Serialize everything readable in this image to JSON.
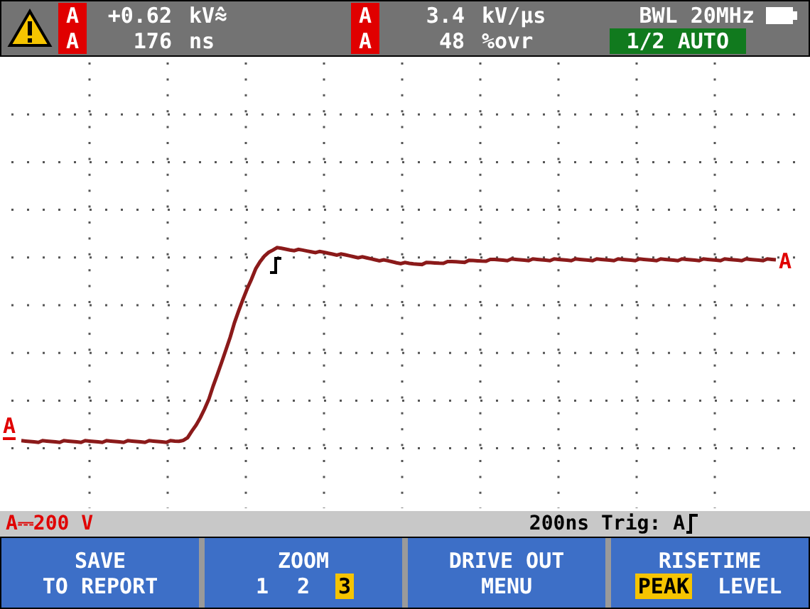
{
  "header": {
    "warning": true,
    "readings": [
      {
        "channel": "A",
        "value": "+0.62",
        "unit": "kV⩯"
      },
      {
        "channel": "A",
        "value": "176",
        "unit": "ns"
      },
      {
        "channel": "A",
        "value": "3.4",
        "unit": "kV/µs"
      },
      {
        "channel": "A",
        "value": "48",
        "unit": "%ovr"
      }
    ],
    "bandwidth": "BWL 20MHz",
    "mode": "1/2 AUTO"
  },
  "trace": {
    "start_marker": "A",
    "end_marker": "A"
  },
  "status_bar": {
    "scale": "A⎓200 V",
    "timebase": "200ns Trig: A"
  },
  "softkeys": [
    {
      "kind": "text",
      "lines": [
        "SAVE",
        "TO REPORT"
      ]
    },
    {
      "kind": "options",
      "title": "ZOOM",
      "options": [
        {
          "label": "1",
          "selected": false
        },
        {
          "label": "2",
          "selected": false
        },
        {
          "label": "3",
          "selected": true
        }
      ]
    },
    {
      "kind": "text",
      "lines": [
        "DRIVE OUT",
        "MENU"
      ]
    },
    {
      "kind": "options",
      "title": "RISETIME",
      "options": [
        {
          "label": "PEAK",
          "selected": true
        },
        {
          "label": "LEVEL",
          "selected": false
        }
      ]
    }
  ]
}
